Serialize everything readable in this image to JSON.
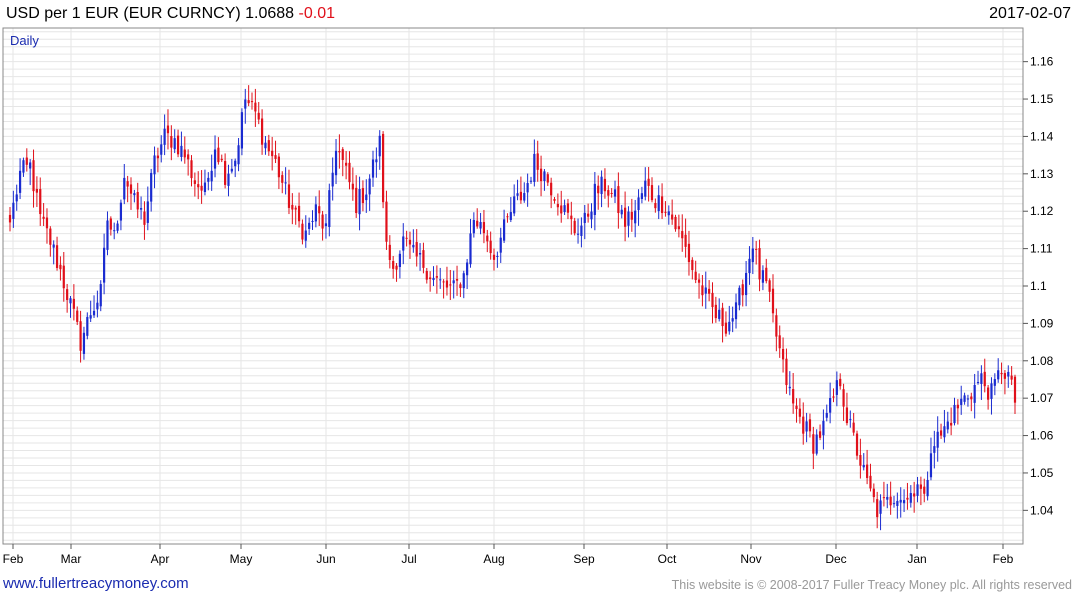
{
  "header": {
    "title": "USD per 1 EUR (EUR CURNCY) 1.0688",
    "change": "-0.01",
    "date": "2017-02-07"
  },
  "colors": {
    "up": "#1a2bd0",
    "down": "#e0101a",
    "grid": "#e6e6e6",
    "frame": "#888888"
  },
  "footer": {
    "link": "www.fullertreacymoney.com",
    "copyright": "This website is © 2008-2017 Fuller Treacy Money plc. All rights reserved"
  },
  "chart_data": {
    "type": "candlestick",
    "period_label": "Daily",
    "ylim": [
      1.031,
      1.169
    ],
    "y_ticks": [
      "1.04",
      "1.05",
      "1.06",
      "1.07",
      "1.08",
      "1.09",
      "1.1",
      "1.11",
      "1.12",
      "1.13",
      "1.14",
      "1.15",
      "1.16"
    ],
    "x_ticks": [
      "Feb",
      "Mar",
      "Apr",
      "May",
      "Jun",
      "Jul",
      "Aug",
      "Sep",
      "Oct",
      "Nov",
      "Dec",
      "Jan",
      "Feb"
    ],
    "last_close": 1.0688,
    "close_anchors": [
      [
        0,
        1.117
      ],
      [
        3,
        1.13
      ],
      [
        6,
        1.132
      ],
      [
        9,
        1.118
      ],
      [
        12,
        1.112
      ],
      [
        15,
        1.104
      ],
      [
        18,
        1.095
      ],
      [
        21,
        1.085
      ],
      [
        24,
        1.093
      ],
      [
        27,
        1.098
      ],
      [
        29,
        1.118
      ],
      [
        31,
        1.113
      ],
      [
        34,
        1.13
      ],
      [
        37,
        1.122
      ],
      [
        40,
        1.118
      ],
      [
        43,
        1.133
      ],
      [
        46,
        1.14
      ],
      [
        49,
        1.139
      ],
      [
        52,
        1.135
      ],
      [
        55,
        1.128
      ],
      [
        58,
        1.125
      ],
      [
        61,
        1.138
      ],
      [
        64,
        1.13
      ],
      [
        67,
        1.134
      ],
      [
        70,
        1.15
      ],
      [
        73,
        1.146
      ],
      [
        76,
        1.138
      ],
      [
        79,
        1.133
      ],
      [
        82,
        1.125
      ],
      [
        85,
        1.118
      ],
      [
        88,
        1.114
      ],
      [
        91,
        1.12
      ],
      [
        94,
        1.115
      ],
      [
        97,
        1.138
      ],
      [
        100,
        1.13
      ],
      [
        103,
        1.122
      ],
      [
        106,
        1.126
      ],
      [
        109,
        1.135
      ],
      [
        110,
        1.138
      ],
      [
        112,
        1.11
      ],
      [
        114,
        1.105
      ],
      [
        117,
        1.112
      ],
      [
        120,
        1.108
      ],
      [
        123,
        1.106
      ],
      [
        126,
        1.102
      ],
      [
        129,
        1.1
      ],
      [
        132,
        1.099
      ],
      [
        135,
        1.103
      ],
      [
        138,
        1.118
      ],
      [
        141,
        1.115
      ],
      [
        144,
        1.108
      ],
      [
        147,
        1.115
      ],
      [
        150,
        1.122
      ],
      [
        153,
        1.125
      ],
      [
        156,
        1.133
      ],
      [
        159,
        1.13
      ],
      [
        162,
        1.125
      ],
      [
        165,
        1.12
      ],
      [
        168,
        1.115
      ],
      [
        171,
        1.117
      ],
      [
        174,
        1.125
      ],
      [
        177,
        1.127
      ],
      [
        180,
        1.123
      ],
      [
        183,
        1.117
      ],
      [
        186,
        1.12
      ],
      [
        189,
        1.127
      ],
      [
        192,
        1.123
      ],
      [
        195,
        1.122
      ],
      [
        198,
        1.116
      ],
      [
        201,
        1.11
      ],
      [
        204,
        1.102
      ],
      [
        207,
        1.097
      ],
      [
        210,
        1.092
      ],
      [
        213,
        1.09
      ],
      [
        216,
        1.093
      ],
      [
        219,
        1.104
      ],
      [
        221,
        1.112
      ],
      [
        223,
        1.103
      ],
      [
        225,
        1.1
      ],
      [
        227,
        1.091
      ],
      [
        230,
        1.078
      ],
      [
        233,
        1.068
      ],
      [
        236,
        1.063
      ],
      [
        239,
        1.058
      ],
      [
        242,
        1.062
      ],
      [
        245,
        1.07
      ],
      [
        247,
        1.075
      ],
      [
        249,
        1.065
      ],
      [
        252,
        1.056
      ],
      [
        255,
        1.047
      ],
      [
        258,
        1.04
      ],
      [
        261,
        1.042
      ],
      [
        264,
        1.045
      ],
      [
        267,
        1.043
      ],
      [
        270,
        1.048
      ],
      [
        272,
        1.042
      ],
      [
        274,
        1.058
      ],
      [
        277,
        1.06
      ],
      [
        280,
        1.065
      ],
      [
        283,
        1.069
      ],
      [
        286,
        1.072
      ],
      [
        289,
        1.075
      ],
      [
        292,
        1.071
      ],
      [
        295,
        1.078
      ],
      [
        297,
        1.076
      ],
      [
        299,
        1.0688
      ]
    ]
  }
}
